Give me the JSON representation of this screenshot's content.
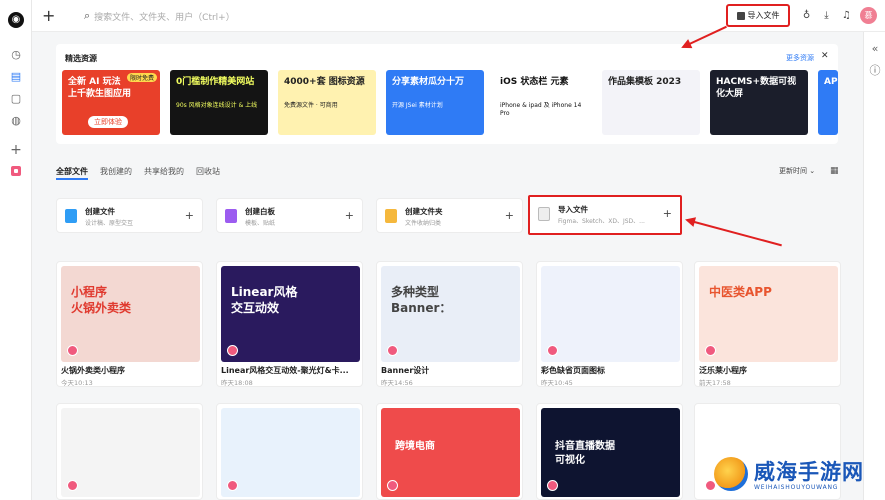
{
  "topbar": {
    "search_placeholder": "搜索文件、文件夹、用户（Ctrl+）",
    "import_label": "导入文件",
    "avatar_text": "慕"
  },
  "resources": {
    "title": "精选资源",
    "more": "更多资源",
    "banners": [
      {
        "title": "全新 AI 玩法\n上千款生图应用",
        "sub": "",
        "button": "立即体验",
        "bg": "#e8402a",
        "fg": "#fff",
        "tag": "限时免费"
      },
      {
        "title": "0门槛制作精美网站",
        "sub": "90s 风格对象连线设计 & 上线",
        "button": "",
        "bg": "#141414",
        "fg": "#f3ff60"
      },
      {
        "title": "4000+套 图标资源",
        "sub": "免费源文件 · 可商用",
        "button": "",
        "bg": "#fff2b0",
        "fg": "#222"
      },
      {
        "title": "分享素材瓜分十万",
        "sub": "开源 JSei 素材计划",
        "button": "",
        "bg": "#2f7bf5",
        "fg": "#fff"
      },
      {
        "title": "iOS 状态栏 元素",
        "sub": "iPhone & ipad 及 iPhone 14 Pro",
        "button": "",
        "bg": "#ffffff",
        "fg": "#111"
      },
      {
        "title": "作品集模板 2023",
        "sub": "",
        "button": "",
        "bg": "#f3f3f8",
        "fg": "#222"
      },
      {
        "title": "HACMS+数据可视化大屏",
        "sub": "",
        "button": "",
        "bg": "#1b1e2b",
        "fg": "#fff"
      },
      {
        "title": "AP",
        "sub": "",
        "button": "",
        "bg": "#2f7bf5",
        "fg": "#fff"
      }
    ]
  },
  "tabs": [
    "全部文件",
    "我创建的",
    "共享给我的",
    "回收站"
  ],
  "sort_label": "更新时间",
  "actions": [
    {
      "name": "创建文件",
      "sub": "设计稿、原型交互",
      "color": "#2f9df5"
    },
    {
      "name": "创建白板",
      "sub": "模板、贴纸",
      "color": "#9c5cf0"
    },
    {
      "name": "创建文件夹",
      "sub": "文件收纳归类",
      "color": "#f5b83d"
    },
    {
      "name": "导入文件",
      "sub": "Figma、Sketch、XD、JSD、...",
      "color": "#555555"
    }
  ],
  "files": [
    {
      "name": "火锅外卖类小程序",
      "time": "今天10:13",
      "thumb_text": "小程序\n火锅外卖类",
      "bg": "#f3d8d2",
      "fg": "#e03a2f"
    },
    {
      "name": "Linear风格交互动效-聚光灯&卡...",
      "time": "昨天18:08",
      "thumb_text": "Linear风格\n交互动效",
      "bg": "#2a1a5e",
      "fg": "#ffffff"
    },
    {
      "name": "Banner设计",
      "time": "昨天14:56",
      "thumb_text": "多种类型\nBanner：",
      "bg": "#e9eef7",
      "fg": "#444"
    },
    {
      "name": "彩色缺省页面图标",
      "time": "昨天10:45",
      "thumb_text": "",
      "bg": "#eef2fb",
      "fg": "#444"
    },
    {
      "name": "泛乐莱小程序",
      "time": "前天17:58",
      "thumb_text": "中医类APP",
      "bg": "#fbe4dc",
      "fg": "#e8552f"
    }
  ],
  "files_row2": [
    {
      "thumb_text": "",
      "bg": "#f4f4f4",
      "fg": "#333"
    },
    {
      "thumb_text": "",
      "bg": "#e8f2fc",
      "fg": "#333"
    },
    {
      "thumb_text": "跨境电商",
      "bg": "#ef4b4b",
      "fg": "#fff"
    },
    {
      "thumb_text": "抖音直播数据\n可视化",
      "bg": "#0e1430",
      "fg": "#fff"
    },
    {
      "thumb_text": "",
      "bg": "#ffffff",
      "fg": "#333"
    }
  ],
  "watermark": {
    "big": "威海手游网",
    "small": "WEIHAISHOUYOUWANG"
  }
}
